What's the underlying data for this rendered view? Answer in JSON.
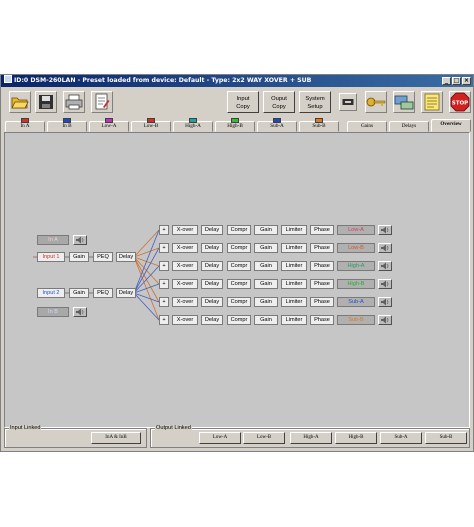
{
  "window": {
    "title": "ID:0 DSM-260LAN - Preset loaded from device: Default - Type: 2x2 WAY XOVER + SUB",
    "controls": [
      "_",
      "□",
      "×"
    ]
  },
  "toolbar": {
    "buttons": [
      {
        "line1": "Input",
        "line2": "Copy"
      },
      {
        "line1": "Ouput",
        "line2": "Copy"
      },
      {
        "line1": "System",
        "line2": "Setup"
      }
    ],
    "stop_label": "STOP"
  },
  "tabs": [
    {
      "label": "In A",
      "color": "#d83020"
    },
    {
      "label": "In B",
      "color": "#2048c0"
    },
    {
      "label": "Low-A",
      "color": "#c030c0"
    },
    {
      "label": "Low-B",
      "color": "#d83020"
    },
    {
      "label": "High-A",
      "color": "#20a0a0"
    },
    {
      "label": "High-B",
      "color": "#30c030"
    },
    {
      "label": "Sub-A",
      "color": "#2048c0"
    },
    {
      "label": "Sub-B",
      "color": "#e07820"
    },
    {
      "label": "Gains",
      "color": ""
    },
    {
      "label": "Delays",
      "color": ""
    },
    {
      "label": "Overview",
      "color": "",
      "active": true
    }
  ],
  "inputs": {
    "in_a": "In A",
    "in_b": "In B",
    "input1": "Input 1",
    "input2": "Input 2",
    "chain": [
      "Gain",
      "PEQ",
      "Delay"
    ]
  },
  "outputs": {
    "plus": "+",
    "chain": [
      "X-over",
      "Delay",
      "Compr",
      "Gain",
      "Limiter",
      "Phase"
    ],
    "channels": [
      {
        "label": "Low-A",
        "color": "#d04060"
      },
      {
        "label": "Low-B",
        "color": "#e05020"
      },
      {
        "label": "High-A",
        "color": "#20a060"
      },
      {
        "label": "High-B",
        "color": "#20b030"
      },
      {
        "label": "Sub-A",
        "color": "#2050d0"
      },
      {
        "label": "Sub-B",
        "color": "#e07820"
      }
    ]
  },
  "bottom": {
    "input_linked_title": "Input Linked",
    "input_linked_button": "InA & InB",
    "output_linked_title": "Output Linked",
    "output_buttons": [
      "Low-A",
      "Low-B",
      "High-A",
      "High-B",
      "Sub-A",
      "Sub-B"
    ]
  }
}
